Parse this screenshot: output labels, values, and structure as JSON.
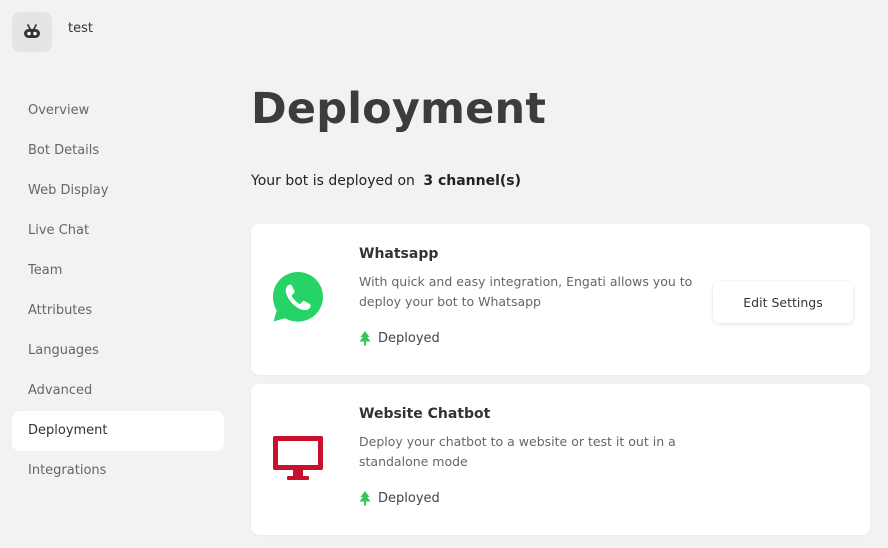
{
  "bot": {
    "name": "test",
    "icon": "robot-icon"
  },
  "sidebar": {
    "items": [
      {
        "label": "Overview"
      },
      {
        "label": "Bot Details"
      },
      {
        "label": "Web Display"
      },
      {
        "label": "Live Chat"
      },
      {
        "label": "Team"
      },
      {
        "label": "Attributes"
      },
      {
        "label": "Languages"
      },
      {
        "label": "Advanced"
      },
      {
        "label": "Deployment",
        "active": true
      },
      {
        "label": "Integrations"
      }
    ]
  },
  "main": {
    "title": "Deployment",
    "summary_prefix": "Your bot is deployed on",
    "summary_count": "3 channel(s)",
    "channels": [
      {
        "name": "Whatsapp",
        "description": "With quick and easy integration, Engati allows you to deploy your bot to Whatsapp",
        "status": "Deployed",
        "icon": "whatsapp-icon",
        "color": "#25d366",
        "button": "Edit Settings"
      },
      {
        "name": "Website Chatbot",
        "description": "Deploy your chatbot to a website or test it out in a standalone mode",
        "status": "Deployed",
        "icon": "monitor-icon",
        "color": "#c8102e"
      }
    ]
  },
  "colors": {
    "background": "#f2f2f2",
    "deployed_green": "#34c759"
  }
}
